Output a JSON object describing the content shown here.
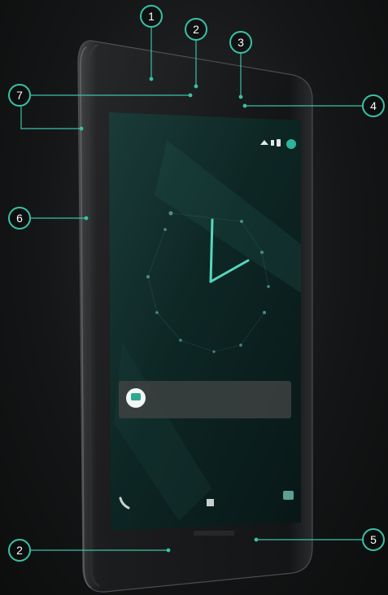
{
  "callouts": {
    "c1": "1",
    "c2_top": "2",
    "c3": "3",
    "c4": "4",
    "c5": "5",
    "c6": "6",
    "c7": "7",
    "c2_bottom": "2"
  },
  "screen": {
    "notification_title": "",
    "notification_time": "",
    "notification_text": "",
    "clock_caption": "",
    "unlock_hint": ""
  },
  "colors": {
    "accent": "#39c2a8",
    "device_body": "#1b1c1d",
    "screen_bg": "#0f2a28"
  },
  "icons": {
    "notification_app": "chat-bubble-icon",
    "left_shortcut": "phone-icon",
    "center_shortcut": "lock-icon",
    "right_shortcut": "camera-icon",
    "status": [
      "wifi-icon",
      "signal-icon",
      "battery-icon",
      "avatar-icon"
    ]
  }
}
